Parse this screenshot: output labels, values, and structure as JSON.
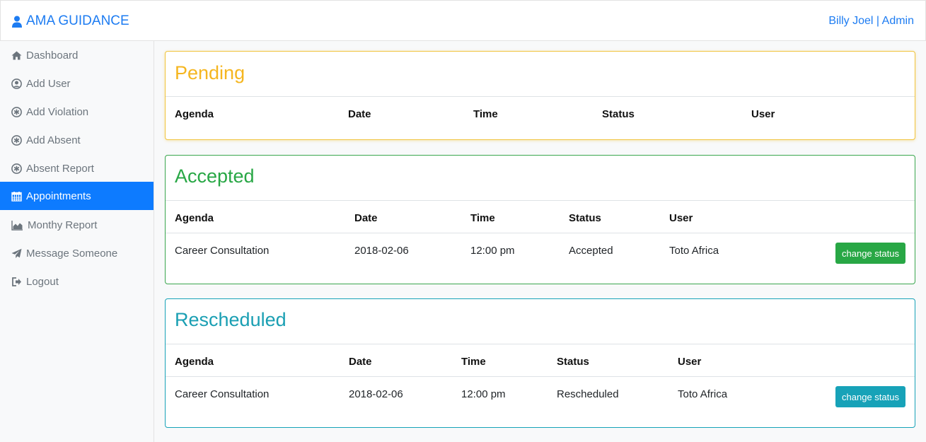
{
  "navbar": {
    "brand": "AMA GUIDANCE",
    "brand_icon": "user-icon",
    "user": "Billy Joel | Admin",
    "accent": "#1d7cf2"
  },
  "sidebar": {
    "items": [
      {
        "label": "Dashboard",
        "icon": "home-icon"
      },
      {
        "label": "Add User",
        "icon": "user-circle-icon"
      },
      {
        "label": "Add Violation",
        "icon": "asterisk-circle-icon"
      },
      {
        "label": "Add Absent",
        "icon": "asterisk-circle-icon"
      },
      {
        "label": "Absent Report",
        "icon": "asterisk-circle-icon"
      },
      {
        "label": "Appointments",
        "icon": "calendar-icon",
        "active": true
      },
      {
        "label": "Monthy Report",
        "icon": "area-chart-icon"
      },
      {
        "label": "Message Someone",
        "icon": "paper-plane-icon"
      },
      {
        "label": "Logout",
        "icon": "sign-out-icon"
      }
    ],
    "active_color": "#0d7bff"
  },
  "sections": {
    "pending": {
      "title": "Pending",
      "color": "#f5b620",
      "headers": [
        "Agenda",
        "Date",
        "Time",
        "Status",
        "User"
      ],
      "rows": []
    },
    "accepted": {
      "title": "Accepted",
      "color": "#28a745",
      "headers": [
        "Agenda",
        "Date",
        "Time",
        "Status",
        "User"
      ],
      "rows": [
        {
          "agenda": "Career Consultation",
          "date": "2018-02-06",
          "time": "12:00 pm",
          "status": "Accepted",
          "user": "Toto Africa",
          "action": "change status"
        }
      ]
    },
    "rescheduled": {
      "title": "Rescheduled",
      "color": "#17a2b8",
      "headers": [
        "Agenda",
        "Date",
        "Time",
        "Status",
        "User"
      ],
      "rows": [
        {
          "agenda": "Career Consultation",
          "date": "2018-02-06",
          "time": "12:00 pm",
          "status": "Rescheduled",
          "user": "Toto Africa",
          "action": "change status"
        }
      ]
    }
  }
}
